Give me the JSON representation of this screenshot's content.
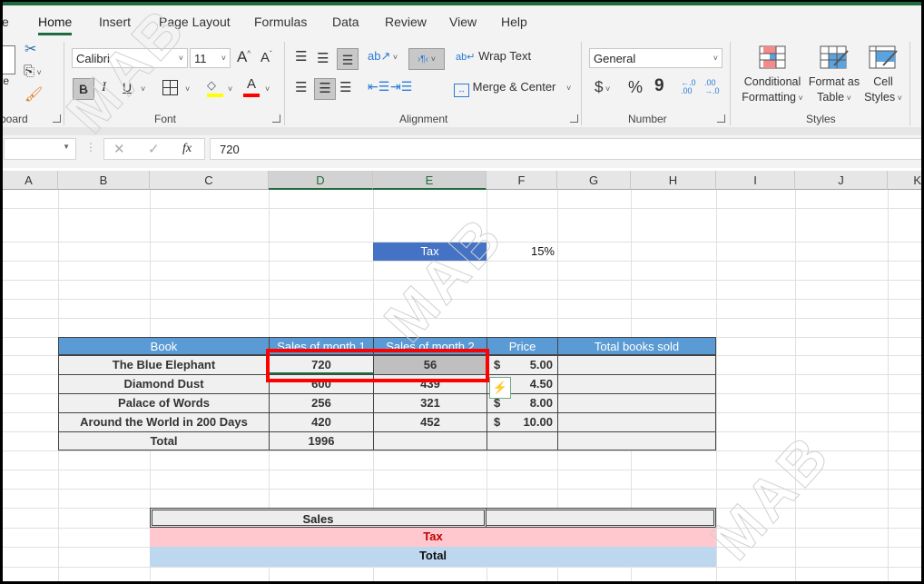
{
  "ribbon_tabs": [
    {
      "label": "e"
    },
    {
      "label": "Home",
      "active": true
    },
    {
      "label": "Insert"
    },
    {
      "label": "Page Layout"
    },
    {
      "label": "Formulas"
    },
    {
      "label": "Data"
    },
    {
      "label": "Review"
    },
    {
      "label": "View"
    },
    {
      "label": "Help"
    }
  ],
  "clipboard": {
    "paste_label": "te",
    "group_label": "board"
  },
  "font": {
    "name": "Calibri",
    "size": "11",
    "bold": "B",
    "italic": "I",
    "underline": "U",
    "font_color_glyph": "A",
    "grow_glyph": "A",
    "shrink_glyph": "A",
    "highlight_color": "#ffff00",
    "font_color": "#ff0000",
    "group_label": "Font"
  },
  "alignment": {
    "wrap_text": "Wrap Text",
    "merge_center": "Merge & Center",
    "group_label": "Alignment"
  },
  "number": {
    "format": "General",
    "currency": "$",
    "percent": "%",
    "comma": "9",
    "group_label": "Number"
  },
  "styles": {
    "conditional_formatting": [
      "Conditional",
      "Formatting"
    ],
    "format_as_table": [
      "Format as",
      "Table"
    ],
    "cell_styles": [
      "Cell",
      "Styles"
    ],
    "group_label": "Styles"
  },
  "formula_bar": {
    "name_box": "",
    "fx": "fx",
    "value": "720"
  },
  "columns": [
    "A",
    "B",
    "C",
    "D",
    "E",
    "F",
    "G",
    "H",
    "I",
    "J",
    "K"
  ],
  "selected_columns": [
    "D",
    "E"
  ],
  "tax_cell": {
    "label": "Tax",
    "value": "15%"
  },
  "sales_table": {
    "headers": [
      "Book",
      "Sales of month 1",
      "Sales of month 2",
      "Price",
      "Total books sold"
    ],
    "rows": [
      {
        "book": "The Blue Elephant",
        "m1": "720",
        "m2": "56",
        "currency": "$",
        "price": "5.00",
        "total": ""
      },
      {
        "book": "Diamond Dust",
        "m1": "600",
        "m2": "439",
        "currency": "$",
        "price": "4.50",
        "total": ""
      },
      {
        "book": "Palace of Words",
        "m1": "256",
        "m2": "321",
        "currency": "$",
        "price": "8.00",
        "total": ""
      },
      {
        "book": "Around the World in 200 Days",
        "m1": "420",
        "m2": "452",
        "currency": "$",
        "price": "10.00",
        "total": ""
      }
    ],
    "total_row": {
      "label": "Total",
      "m1": "1996",
      "m2": "",
      "price": "",
      "total": ""
    }
  },
  "summary": {
    "sales_label": "Sales",
    "tax_label": "Tax",
    "total_label": "Total"
  },
  "colors": {
    "accent_green": "#1e6b3e",
    "header_blue": "#5b9bd5",
    "tax_blue": "#4472c4",
    "selection_red": "#ff0000",
    "tax_pink": "#ffc7ce",
    "tax_text": "#c00000",
    "total_blue": "#bdd7ee"
  },
  "watermark": "MAB"
}
